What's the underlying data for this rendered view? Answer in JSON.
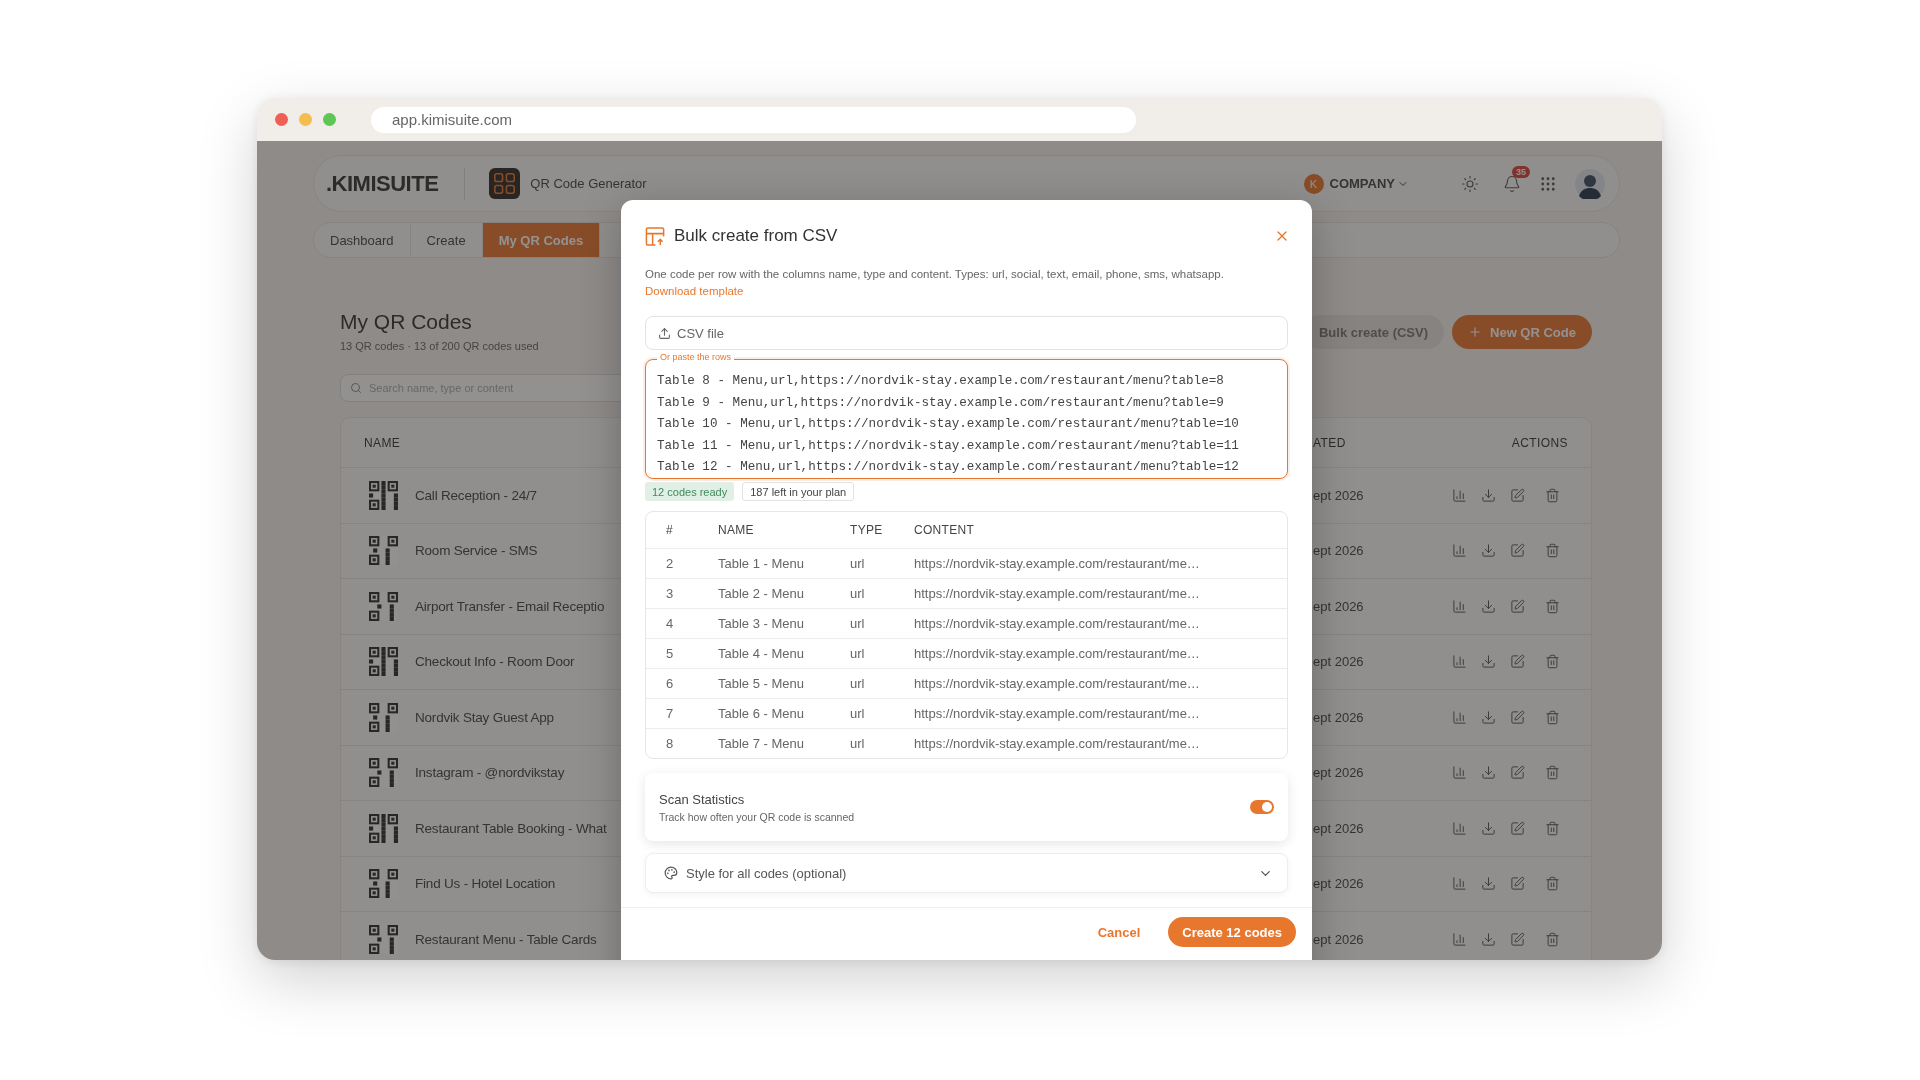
{
  "browser": {
    "url": "app.kimisuite.com"
  },
  "header": {
    "logo": ".KIMISUITE",
    "app_name": "QR Code Generator",
    "company_initial": "K",
    "company": "COMPANY",
    "notifications": "35"
  },
  "nav_tabs": [
    {
      "label": "Dashboard",
      "selected": false
    },
    {
      "label": "Create",
      "selected": false
    },
    {
      "label": "My QR Codes",
      "selected": true
    }
  ],
  "page": {
    "title": "My QR Codes",
    "subtitle": "13 QR codes · 13 of 200 QR codes used",
    "search": {
      "placeholder": "Search name, type or content"
    },
    "buttons": [
      {
        "label": "Bulk create (CSV)",
        "kind": "secondary"
      },
      {
        "label": "New QR Code",
        "kind": "primary"
      }
    ]
  },
  "codes_table": {
    "columns": [
      "NAME",
      "ATED",
      "ACTIONS"
    ],
    "rows": [
      {
        "name": "Call Reception - 24/7",
        "created": "ept 2026"
      },
      {
        "name": "Room Service - SMS",
        "created": "ept 2026"
      },
      {
        "name": "Airport Transfer - Email Receptio",
        "created": "ept 2026"
      },
      {
        "name": "Checkout Info - Room Door",
        "created": "ept 2026"
      },
      {
        "name": "Nordvik Stay Guest App",
        "created": "ept 2026"
      },
      {
        "name": "Instagram - @nordvikstay",
        "created": "ept 2026"
      },
      {
        "name": "Restaurant Table Booking - What",
        "created": "ept 2026"
      },
      {
        "name": "Find Us - Hotel Location",
        "created": "ept 2026"
      },
      {
        "name": "Restaurant Menu - Table Cards",
        "created": "ept 2026"
      }
    ]
  },
  "modal": {
    "title": "Bulk create from CSV",
    "description": "One code per row with the columns name, type and content. Types: url, social, text, email, phone, sms, whatsapp.",
    "template_link": "Download template",
    "file_field": {
      "placeholder": "CSV file"
    },
    "paste": {
      "label": "Or paste the rows",
      "lines": [
        "Table 8 - Menu,url,https://nordvik-stay.example.com/restaurant/menu?table=8",
        "Table 9 - Menu,url,https://nordvik-stay.example.com/restaurant/menu?table=9",
        "Table 10 - Menu,url,https://nordvik-stay.example.com/restaurant/menu?table=10",
        "Table 11 - Menu,url,https://nordvik-stay.example.com/restaurant/menu?table=11",
        "Table 12 - Menu,url,https://nordvik-stay.example.com/restaurant/menu?table=12"
      ]
    },
    "badges": [
      {
        "label": "12 codes ready",
        "kind": "success"
      },
      {
        "label": "187 left in your plan",
        "kind": "neutral"
      }
    ],
    "preview": {
      "columns": [
        "#",
        "NAME",
        "TYPE",
        "CONTENT"
      ],
      "rows": [
        {
          "index": "2",
          "name": "Table 1 - Menu",
          "type": "url",
          "content": "https://nordvik-stay.example.com/restaurant/me…"
        },
        {
          "index": "3",
          "name": "Table 2 - Menu",
          "type": "url",
          "content": "https://nordvik-stay.example.com/restaurant/me…"
        },
        {
          "index": "4",
          "name": "Table 3 - Menu",
          "type": "url",
          "content": "https://nordvik-stay.example.com/restaurant/me…"
        },
        {
          "index": "5",
          "name": "Table 4 - Menu",
          "type": "url",
          "content": "https://nordvik-stay.example.com/restaurant/me…"
        },
        {
          "index": "6",
          "name": "Table 5 - Menu",
          "type": "url",
          "content": "https://nordvik-stay.example.com/restaurant/me…"
        },
        {
          "index": "7",
          "name": "Table 6 - Menu",
          "type": "url",
          "content": "https://nordvik-stay.example.com/restaurant/me…"
        },
        {
          "index": "8",
          "name": "Table 7 - Menu",
          "type": "url",
          "content": "https://nordvik-stay.example.com/restaurant/me…"
        }
      ]
    },
    "scan_statistics": {
      "title": "Scan Statistics",
      "description": "Track how often your QR code is scanned",
      "on": true
    },
    "style_section": {
      "label": "Style for all codes (optional)",
      "expanded": false
    },
    "buttons": [
      {
        "label": "Cancel",
        "kind": "text"
      },
      {
        "label": "Create 12 codes",
        "kind": "primary"
      }
    ]
  }
}
